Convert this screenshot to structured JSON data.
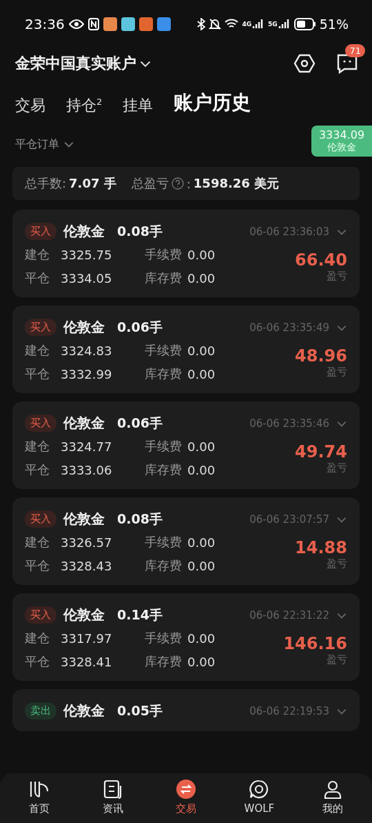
{
  "status_bar": {
    "time": "23:36",
    "networks": [
      "4G",
      "5G"
    ],
    "battery": "51%"
  },
  "header": {
    "account": "金荣中国真实账户",
    "badge": "71"
  },
  "tabs": [
    {
      "label": "交易",
      "selected": false
    },
    {
      "label": "持仓$^{2}$",
      "selected": false
    },
    {
      "label": "挂单",
      "selected": false
    },
    {
      "label": "账户历史",
      "selected": true
    }
  ],
  "filter": {
    "label": "平仓订单"
  },
  "price_tag": {
    "price": "3334.09",
    "name": "伦敦金"
  },
  "summary": {
    "lots_label": "总手数:",
    "lots": "7.07 手",
    "pnl_label": "总盈亏",
    "pnl_colon": ":",
    "pnl": "1598.26 美元"
  },
  "orders": [
    {
      "kind": "buy",
      "side": "买入",
      "symbol": "伦敦金",
      "lots": "0.08手",
      "time": "06-06 23:36:03",
      "open_label": "建仓",
      "open": "3325.75",
      "close_label": "平仓",
      "close": "3334.05",
      "fee_label": "手续费",
      "fee": "0.00",
      "swap_label": "库存费",
      "swap": "0.00",
      "profit": "66.40",
      "profit_label": "盈亏"
    },
    {
      "kind": "buy",
      "side": "买入",
      "symbol": "伦敦金",
      "lots": "0.06手",
      "time": "06-06 23:35:49",
      "open_label": "建仓",
      "open": "3324.83",
      "close_label": "平仓",
      "close": "3332.99",
      "fee_label": "手续费",
      "fee": "0.00",
      "swap_label": "库存费",
      "swap": "0.00",
      "profit": "48.96",
      "profit_label": "盈亏"
    },
    {
      "kind": "buy",
      "side": "买入",
      "symbol": "伦敦金",
      "lots": "0.06手",
      "time": "06-06 23:35:46",
      "open_label": "建仓",
      "open": "3324.77",
      "close_label": "平仓",
      "close": "3333.06",
      "fee_label": "手续费",
      "fee": "0.00",
      "swap_label": "库存费",
      "swap": "0.00",
      "profit": "49.74",
      "profit_label": "盈亏"
    },
    {
      "kind": "buy",
      "side": "买入",
      "symbol": "伦敦金",
      "lots": "0.08手",
      "time": "06-06 23:07:57",
      "open_label": "建仓",
      "open": "3326.57",
      "close_label": "平仓",
      "close": "3328.43",
      "fee_label": "手续费",
      "fee": "0.00",
      "swap_label": "库存费",
      "swap": "0.00",
      "profit": "14.88",
      "profit_label": "盈亏"
    },
    {
      "kind": "buy",
      "side": "买入",
      "symbol": "伦敦金",
      "lots": "0.14手",
      "time": "06-06 22:31:22",
      "open_label": "建仓",
      "open": "3317.97",
      "close_label": "平仓",
      "close": "3328.41",
      "fee_label": "手续费",
      "fee": "0.00",
      "swap_label": "库存费",
      "swap": "0.00",
      "profit": "146.16",
      "profit_label": "盈亏"
    },
    {
      "kind": "sell",
      "side": "卖出",
      "symbol": "伦敦金",
      "lots": "0.05手",
      "time": "06-06 22:19:53"
    }
  ],
  "nav": [
    {
      "kind": "home",
      "label": "首页",
      "selected": false
    },
    {
      "kind": "news",
      "label": "资讯",
      "selected": false
    },
    {
      "kind": "trade",
      "label": "交易",
      "selected": true
    },
    {
      "kind": "wolf",
      "label": "WOLF",
      "selected": false
    },
    {
      "kind": "me",
      "label": "我的",
      "selected": false
    }
  ]
}
